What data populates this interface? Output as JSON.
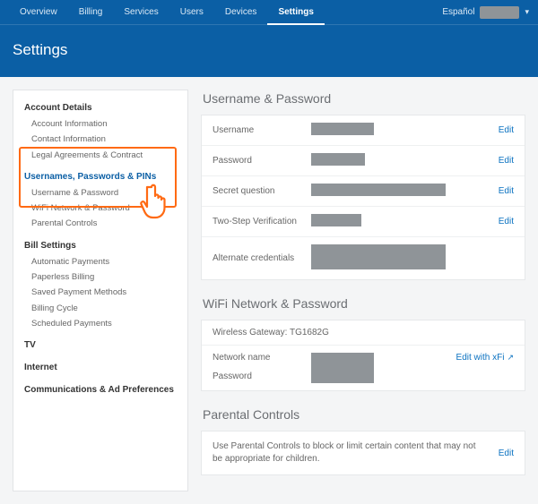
{
  "nav": {
    "items": [
      "Overview",
      "Billing",
      "Services",
      "Users",
      "Devices",
      "Settings"
    ],
    "active": "Settings",
    "language": "Español"
  },
  "page_title": "Settings",
  "sidebar": {
    "groups": [
      {
        "title": "Account Details",
        "items": [
          "Account Information",
          "Contact Information",
          "Legal Agreements & Contract"
        ]
      },
      {
        "title": "Usernames, Passwords & PINs",
        "title_link": true,
        "highlighted": true,
        "items": [
          "Username & Password",
          "WiFi Network & Password",
          "Parental Controls"
        ]
      },
      {
        "title": "Bill Settings",
        "items": [
          "Automatic Payments",
          "Paperless Billing",
          "Saved Payment Methods",
          "Billing Cycle",
          "Scheduled Payments"
        ]
      },
      {
        "title": "TV",
        "items": []
      },
      {
        "title": "Internet",
        "items": []
      },
      {
        "title": "Communications & Ad Preferences",
        "items": []
      }
    ]
  },
  "sections": {
    "username_password": {
      "title": "Username & Password",
      "rows": [
        {
          "label": "Username",
          "action": "Edit"
        },
        {
          "label": "Password",
          "action": "Edit"
        },
        {
          "label": "Secret question",
          "action": "Edit"
        },
        {
          "label": "Two-Step Verification",
          "action": "Edit"
        },
        {
          "label": "Alternate credentials",
          "action": ""
        }
      ]
    },
    "wifi": {
      "title": "WiFi Network & Password",
      "gateway_label": "Wireless Gateway:",
      "gateway_model": "TG1682G",
      "network_label": "Network name",
      "password_label": "Password",
      "edit_label": "Edit with xFi"
    },
    "parental": {
      "title": "Parental Controls",
      "text": "Use Parental Controls to block or limit certain content that may not be appropriate for children.",
      "edit_label": "Edit"
    }
  }
}
